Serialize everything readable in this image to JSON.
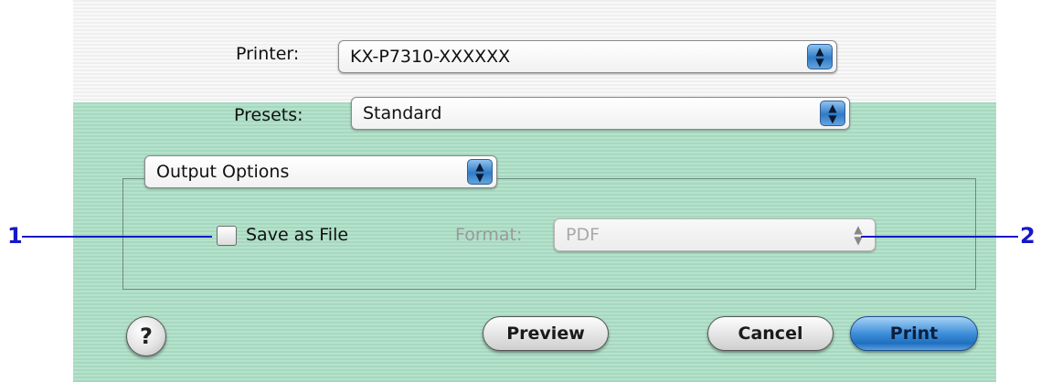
{
  "printer": {
    "label": "Printer:",
    "value": "KX-P7310-XXXXXX"
  },
  "presets": {
    "label": "Presets:",
    "value": "Standard"
  },
  "panel_selector": {
    "value": "Output Options"
  },
  "output_options": {
    "save_as_file_label": "Save as File",
    "save_as_file_checked": false,
    "format_label": "Format:",
    "format_value": "PDF"
  },
  "buttons": {
    "help": "?",
    "preview": "Preview",
    "cancel": "Cancel",
    "print": "Print"
  },
  "callouts": {
    "left": "1",
    "right": "2"
  },
  "colors": {
    "callout": "#1717c9",
    "dialog_bg": "#b0dfc7",
    "default_button": "#2f7bc6"
  }
}
